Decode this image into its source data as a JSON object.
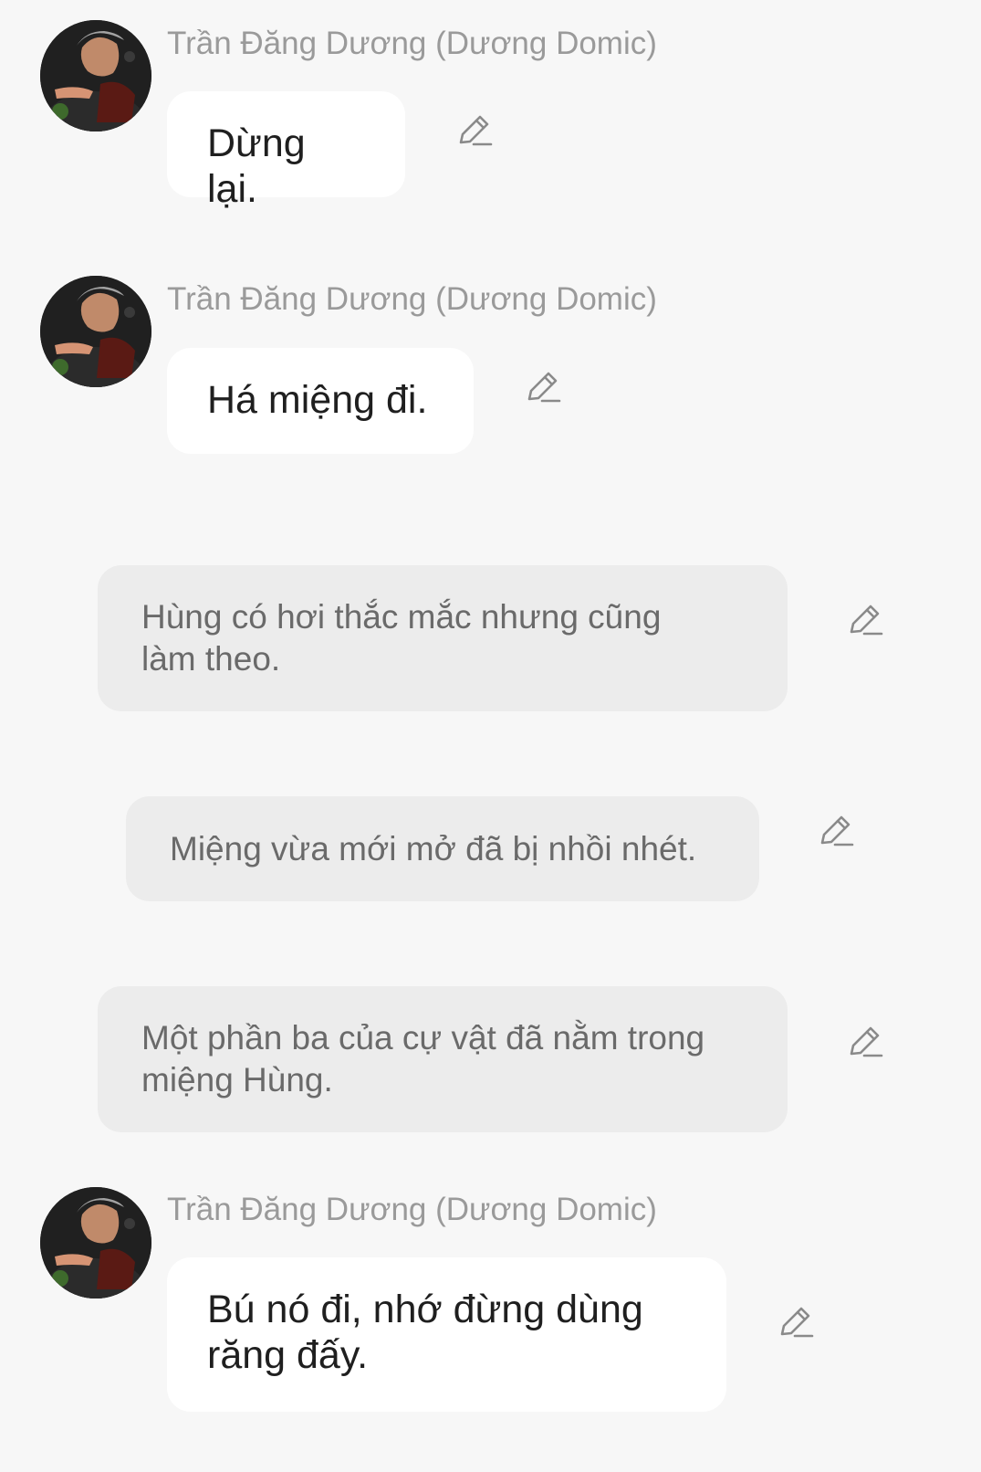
{
  "messages": [
    {
      "type": "character",
      "sender": "Trần Đăng Dương (Dương Domic)",
      "text": "Dừng lại."
    },
    {
      "type": "character",
      "sender": "Trần Đăng Dương (Dương Domic)",
      "text": "Há miệng đi."
    },
    {
      "type": "narration",
      "text": "Hùng có hơi thắc mắc nhưng cũng làm theo."
    },
    {
      "type": "narration",
      "text": "Miệng vừa mới mở đã bị nhồi nhét."
    },
    {
      "type": "narration",
      "text": "Một phần ba của cự vật đã nằm trong miệng Hùng."
    },
    {
      "type": "character",
      "sender": "Trần Đăng Dương (Dương Domic)",
      "text": "Bú nó đi, nhớ đừng dùng răng đấy."
    }
  ],
  "icons": {
    "avatar": "avatar-photo",
    "edit": "pencil-edit-icon"
  },
  "colors": {
    "background": "#f7f7f7",
    "character_bubble": "#ffffff",
    "narration_bubble": "#ececec",
    "sender_name": "#9a9a9a",
    "icon": "#8a8a8a"
  }
}
